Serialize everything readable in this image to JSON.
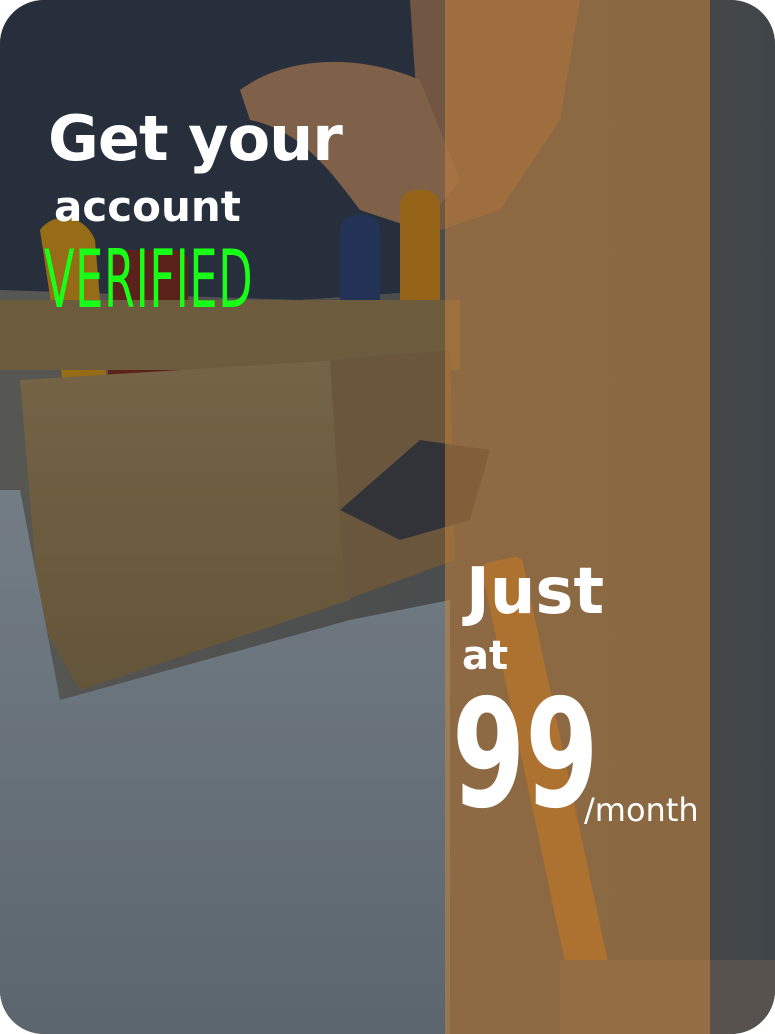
{
  "headline": {
    "line1": "Get your",
    "line2": "account",
    "line3": "VERIFIED"
  },
  "offer": {
    "just": "Just",
    "at": "at",
    "amount": "99",
    "unit": "/month"
  },
  "colors": {
    "headline_text": "#ffffff",
    "verified_accent": "#18ff18",
    "band_overlay": "#c4843c"
  }
}
